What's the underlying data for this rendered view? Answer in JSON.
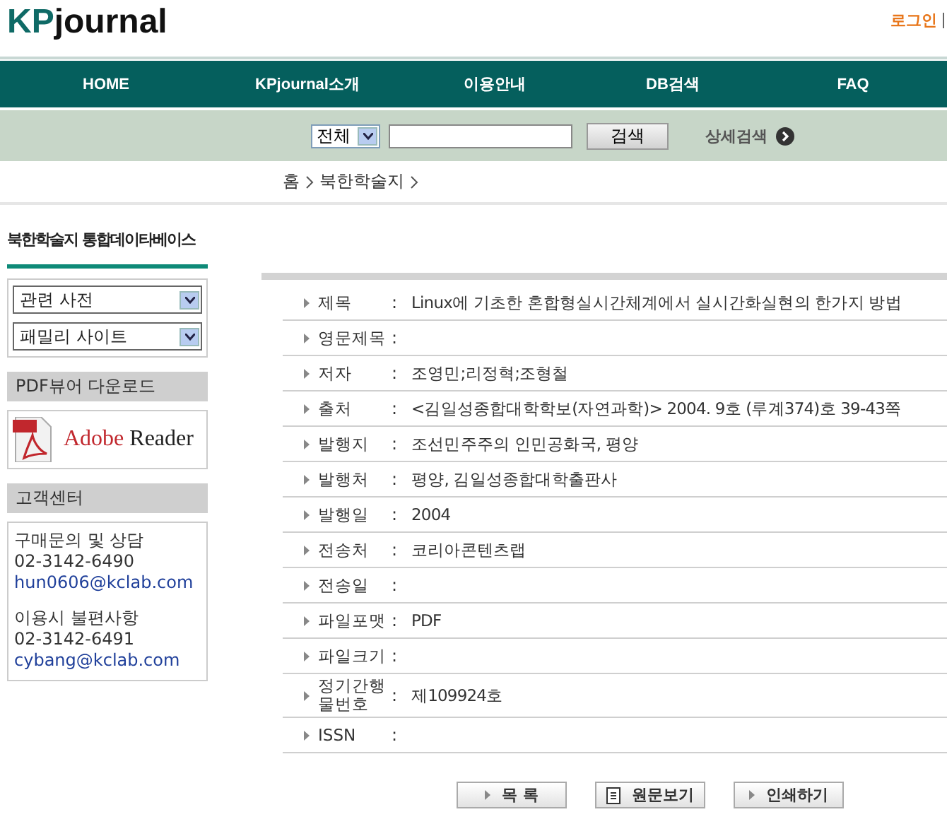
{
  "header": {
    "logo_prefix": "KP",
    "logo_suffix": "journal",
    "login": "로그인"
  },
  "nav": [
    "HOME",
    "KPjournal소개",
    "이용안내",
    "DB검색",
    "FAQ"
  ],
  "search": {
    "scope": "전체",
    "button": "검색",
    "advanced": "상세검색"
  },
  "breadcrumb": [
    "홈",
    "북한학술지"
  ],
  "sidebar": {
    "title": "북한학술지 통합데이타베이스",
    "selects": [
      "관련 사전",
      "패밀리 사이트"
    ],
    "pdf_heading": "PDF뷰어 다운로드",
    "adobe": {
      "brand": "Adobe",
      "product": "Reader"
    },
    "support_heading": "고객센터",
    "contacts": [
      {
        "label": "구매문의 및 상담",
        "phone": "02-3142-6490",
        "email": "hun0606@kclab.com"
      },
      {
        "label": "이용시 불편사항",
        "phone": "02-3142-6491",
        "email": "cybang@kclab.com"
      }
    ]
  },
  "separator": ":",
  "details": [
    {
      "label": "제목",
      "value": "Linux에 기초한 혼합형실시간체계에서 실시간화실현의 한가지 방법"
    },
    {
      "label": "영문제목"
    },
    {
      "label": "저자",
      "value": "조영민;리정혁;조형철"
    },
    {
      "label": "출처",
      "value": "<김일성종합대학학보(자연과학)> 2004. 9호 (루계374)호 39-43쪽"
    },
    {
      "label": "발행지",
      "value": "조선민주주의 인민공화국, 평양"
    },
    {
      "label": "발행처",
      "value": "평양, 김일성종합대학출판사"
    },
    {
      "label": "발행일",
      "value": "2004"
    },
    {
      "label": "전송처",
      "value": "코리아콘텐츠랩"
    },
    {
      "label": "전송일"
    },
    {
      "label": "파일포맷",
      "value": "PDF"
    },
    {
      "label": "파일크기"
    },
    {
      "label": "정기간행물번호",
      "value": "제109924호"
    },
    {
      "label": "ISSN"
    }
  ],
  "buttons": [
    {
      "label": "목 록",
      "kind": "arrow"
    },
    {
      "label": "원문보기",
      "kind": "document"
    },
    {
      "label": "인쇄하기",
      "kind": "arrow"
    }
  ]
}
